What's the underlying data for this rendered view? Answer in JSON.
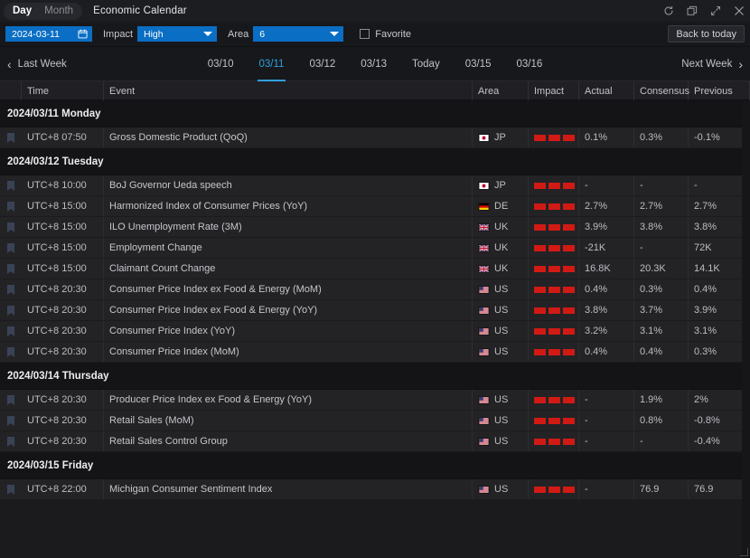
{
  "titlebar": {
    "view_tabs": [
      {
        "label": "Day",
        "active": true
      },
      {
        "label": "Month",
        "active": false
      }
    ],
    "app_title": "Economic Calendar",
    "controls": [
      {
        "name": "refresh-icon",
        "label": "Refresh"
      },
      {
        "name": "restore-window-icon",
        "label": "Restore"
      },
      {
        "name": "expand-icon",
        "label": "Expand"
      },
      {
        "name": "close-icon",
        "label": "Close"
      }
    ]
  },
  "filterbar": {
    "date_value": "2024-03-11",
    "calendar_icon": "calendar-icon",
    "impact_label": "Impact",
    "impact_value": "High",
    "area_label": "Area",
    "area_value": "6",
    "favorite_label": "Favorite",
    "favorite_checked": false,
    "back_to_today": "Back to today",
    "accent_blue": "#0a6ec4"
  },
  "daynav": {
    "prev_label": "Last Week",
    "next_label": "Next Week",
    "accent": "#2f9fe0",
    "tabs": [
      {
        "label": "03/10",
        "active": false
      },
      {
        "label": "03/11",
        "active": true
      },
      {
        "label": "03/12",
        "active": false
      },
      {
        "label": "03/13",
        "active": false
      },
      {
        "label": "Today",
        "active": false
      },
      {
        "label": "03/15",
        "active": false
      },
      {
        "label": "03/16",
        "active": false
      }
    ]
  },
  "table": {
    "columns": [
      {
        "key": "fav",
        "label": ""
      },
      {
        "key": "time",
        "label": "Time"
      },
      {
        "key": "event",
        "label": "Event"
      },
      {
        "key": "area",
        "label": "Area"
      },
      {
        "key": "impact",
        "label": "Impact"
      },
      {
        "key": "actual",
        "label": "Actual"
      },
      {
        "key": "consensus",
        "label": "Consensus"
      },
      {
        "key": "previous",
        "label": "Previous"
      }
    ],
    "impact_color": "#d11a14",
    "groups": [
      {
        "header": "2024/03/11 Monday",
        "rows": [
          {
            "time": "UTC+8 07:50",
            "event": "Gross Domestic Product (QoQ)",
            "area": "JP",
            "impact": 3,
            "actual": "0.1%",
            "consensus": "0.3%",
            "previous": "-0.1%"
          }
        ]
      },
      {
        "header": "2024/03/12 Tuesday",
        "rows": [
          {
            "time": "UTC+8 10:00",
            "event": "BoJ Governor Ueda speech",
            "area": "JP",
            "impact": 3,
            "actual": "-",
            "consensus": "-",
            "previous": "-"
          },
          {
            "time": "UTC+8 15:00",
            "event": "Harmonized Index of Consumer Prices (YoY)",
            "area": "DE",
            "impact": 3,
            "actual": "2.7%",
            "consensus": "2.7%",
            "previous": "2.7%"
          },
          {
            "time": "UTC+8 15:00",
            "event": "ILO Unemployment Rate (3M)",
            "area": "UK",
            "impact": 3,
            "actual": "3.9%",
            "consensus": "3.8%",
            "previous": "3.8%"
          },
          {
            "time": "UTC+8 15:00",
            "event": "Employment Change",
            "area": "UK",
            "impact": 3,
            "actual": "-21K",
            "consensus": "-",
            "previous": "72K"
          },
          {
            "time": "UTC+8 15:00",
            "event": "Claimant Count Change",
            "area": "UK",
            "impact": 3,
            "actual": "16.8K",
            "consensus": "20.3K",
            "previous": "14.1K"
          },
          {
            "time": "UTC+8 20:30",
            "event": "Consumer Price Index ex Food & Energy (MoM)",
            "area": "US",
            "impact": 3,
            "actual": "0.4%",
            "consensus": "0.3%",
            "previous": "0.4%"
          },
          {
            "time": "UTC+8 20:30",
            "event": "Consumer Price Index ex Food & Energy (YoY)",
            "area": "US",
            "impact": 3,
            "actual": "3.8%",
            "consensus": "3.7%",
            "previous": "3.9%"
          },
          {
            "time": "UTC+8 20:30",
            "event": "Consumer Price Index (YoY)",
            "area": "US",
            "impact": 3,
            "actual": "3.2%",
            "consensus": "3.1%",
            "previous": "3.1%"
          },
          {
            "time": "UTC+8 20:30",
            "event": "Consumer Price Index (MoM)",
            "area": "US",
            "impact": 3,
            "actual": "0.4%",
            "consensus": "0.4%",
            "previous": "0.3%"
          }
        ]
      },
      {
        "header": "2024/03/14 Thursday",
        "rows": [
          {
            "time": "UTC+8 20:30",
            "event": "Producer Price Index ex Food & Energy (YoY)",
            "area": "US",
            "impact": 3,
            "actual": "-",
            "consensus": "1.9%",
            "previous": "2%"
          },
          {
            "time": "UTC+8 20:30",
            "event": "Retail Sales (MoM)",
            "area": "US",
            "impact": 3,
            "actual": "-",
            "consensus": "0.8%",
            "previous": "-0.8%"
          },
          {
            "time": "UTC+8 20:30",
            "event": "Retail Sales Control Group",
            "area": "US",
            "impact": 3,
            "actual": "-",
            "consensus": "-",
            "previous": "-0.4%"
          }
        ]
      },
      {
        "header": "2024/03/15 Friday",
        "rows": [
          {
            "time": "UTC+8 22:00",
            "event": "Michigan Consumer Sentiment Index",
            "area": "US",
            "impact": 3,
            "actual": "-",
            "consensus": "76.9",
            "previous": "76.9"
          }
        ]
      }
    ]
  }
}
